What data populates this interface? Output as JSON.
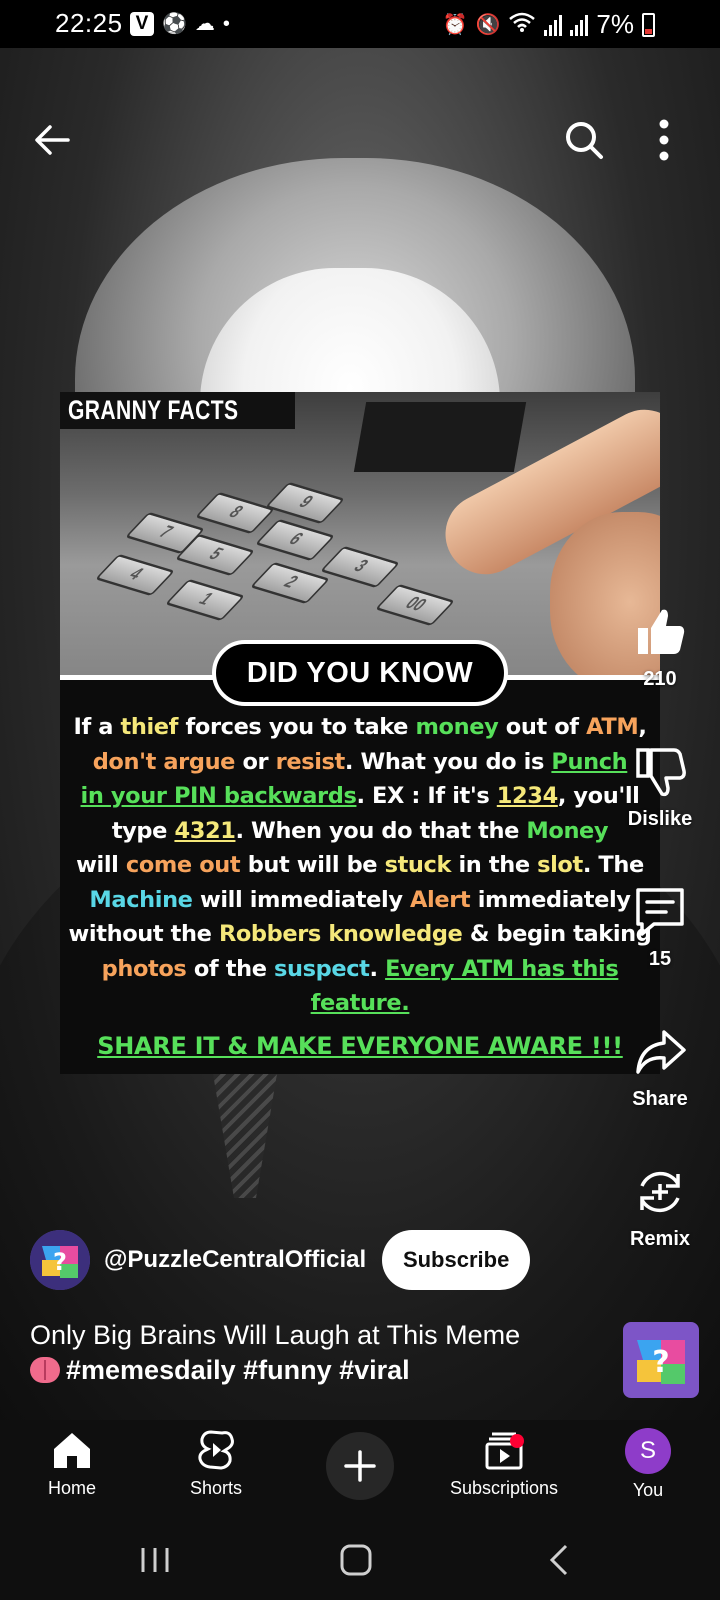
{
  "status_bar": {
    "time": "22:25",
    "carrier_badge": "V",
    "battery": "7%"
  },
  "video": {
    "meme": {
      "brand": "GRANNY FACTS",
      "headline": "DID YOU KNOW",
      "body": {
        "l1": [
          "If a ",
          "thief",
          " forces you to take ",
          "money",
          " out of ",
          "ATM",
          ","
        ],
        "l2": [
          "don't argue",
          " or ",
          "resist",
          ". What you do is ",
          "Punch"
        ],
        "l3": [
          "in your PIN backwards",
          ". EX : If it's ",
          "1234",
          ", you'll"
        ],
        "l4": [
          "type ",
          "4321",
          ". When you do that the ",
          "Money"
        ],
        "l5": [
          "will ",
          "come out",
          " but will be ",
          "stuck",
          " in the ",
          "slot",
          ". The"
        ],
        "l6": [
          "Machine",
          " will immediately ",
          "Alert",
          " immediately"
        ],
        "l7": [
          "without the ",
          "Robbers knowledge",
          " & begin taking"
        ],
        "l8": [
          "photos",
          " of the ",
          "suspect",
          ". ",
          "Every ATM has this"
        ],
        "l9": [
          "feature."
        ]
      },
      "cta": "SHARE IT & MAKE EVERYONE AWARE !!!"
    }
  },
  "rail": {
    "like_count": "210",
    "dislike_label": "Dislike",
    "comment_count": "15",
    "share_label": "Share",
    "remix_label": "Remix"
  },
  "channel": {
    "handle": "@PuzzleCentralOfficial",
    "subscribe_label": "Subscribe"
  },
  "video_title": {
    "line1": "Only Big Brains Will Laugh at This Meme",
    "line2": "#memesdaily #funny #viral"
  },
  "bottom_nav": {
    "home": "Home",
    "shorts": "Shorts",
    "subscriptions": "Subscriptions",
    "you": "You",
    "you_initial": "S"
  },
  "colors": {
    "yellow": "#f5e87a",
    "green": "#57e05a",
    "orange": "#f7a35c",
    "cyan": "#59d7e6",
    "you_avatar": "#8e3cc9",
    "notification_dot": "#ff0033"
  }
}
